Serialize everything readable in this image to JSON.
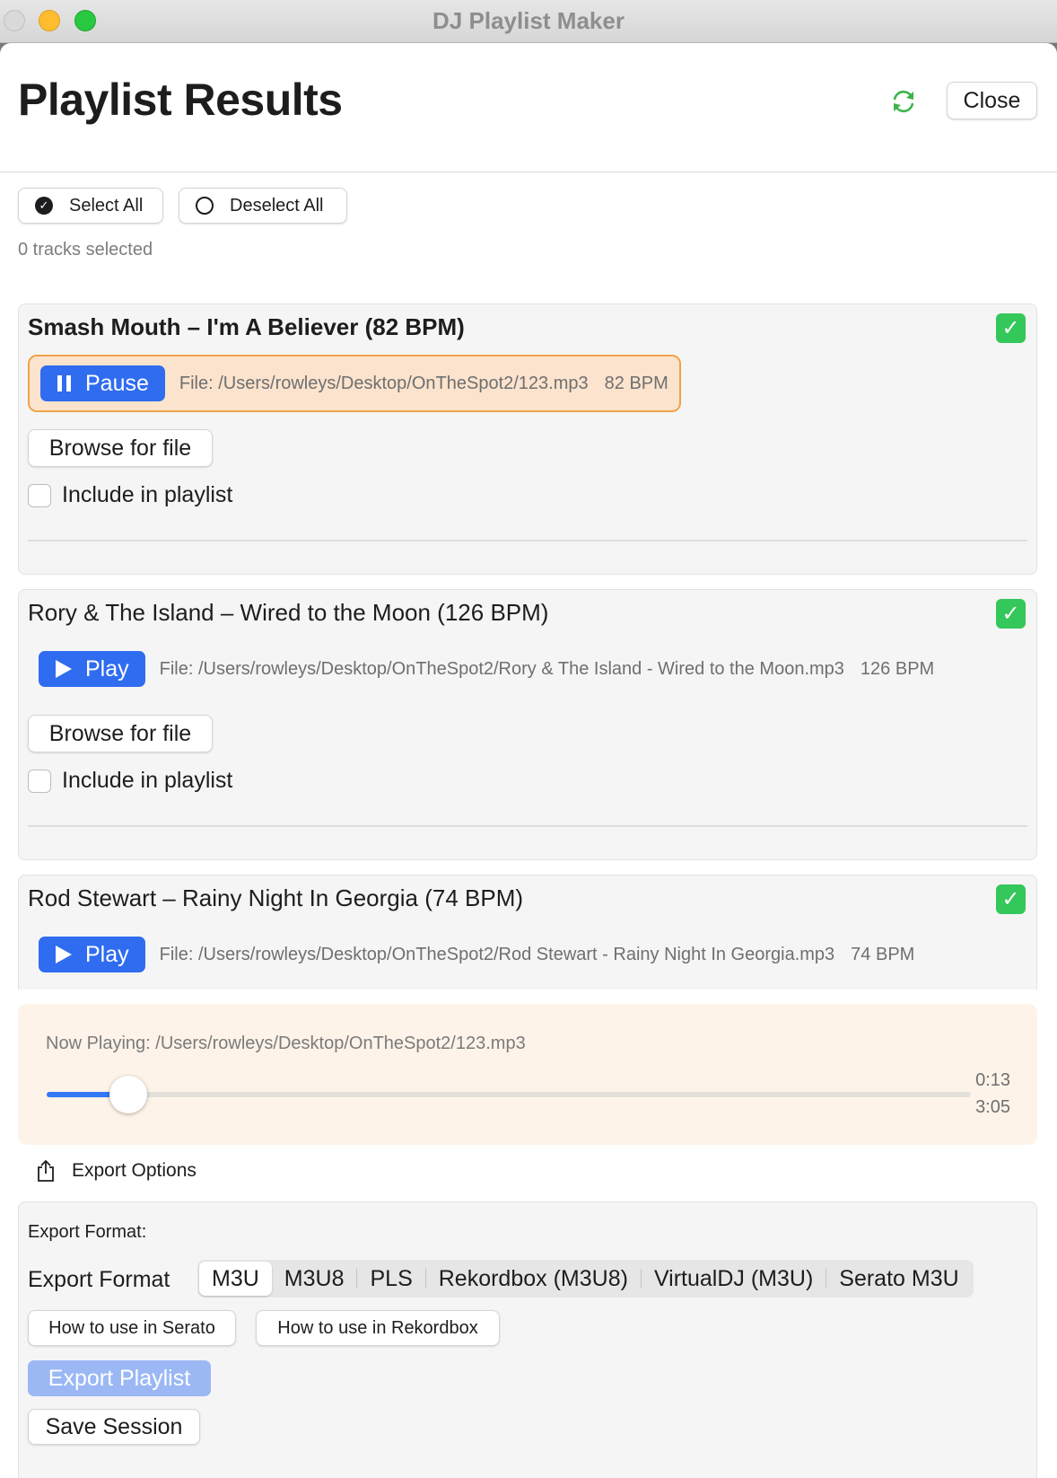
{
  "window": {
    "title": "DJ Playlist Maker"
  },
  "header": {
    "title": "Playlist Results",
    "close_label": "Close"
  },
  "selection": {
    "select_all_label": "Select All",
    "deselect_all_label": "Deselect All",
    "count_text": "0 tracks selected"
  },
  "tracks": [
    {
      "title": "Smash Mouth – I'm A Believer (82 BPM)",
      "play_label": "Pause",
      "file_text": "File: /Users/rowleys/Desktop/OnTheSpot2/123.mp3",
      "bpm_text": "82 BPM",
      "browse_label": "Browse for file",
      "include_label": "Include in playlist",
      "check_glyph": "✓"
    },
    {
      "title": "Rory & The Island – Wired to the Moon (126 BPM)",
      "play_label": "Play",
      "file_text": "File: /Users/rowleys/Desktop/OnTheSpot2/Rory & The Island - Wired to the Moon.mp3",
      "bpm_text": "126 BPM",
      "browse_label": "Browse for file",
      "include_label": "Include in playlist",
      "check_glyph": "✓"
    },
    {
      "title": "Rod Stewart – Rainy Night In Georgia (74 BPM)",
      "play_label": "Play",
      "file_text": "File: /Users/rowleys/Desktop/OnTheSpot2/Rod Stewart - Rainy Night In Georgia.mp3",
      "bpm_text": "74 BPM",
      "check_glyph": "✓"
    }
  ],
  "now_playing": {
    "label": "Now Playing: /Users/rowleys/Desktop/OnTheSpot2/123.mp3",
    "elapsed": "0:13",
    "total": "3:05",
    "progress_fraction": 0.088
  },
  "export": {
    "section_label": "Export Options",
    "format_title": "Export Format:",
    "format_label": "Export Format",
    "formats": [
      "M3U",
      "M3U8",
      "PLS",
      "Rekordbox (M3U8)",
      "VirtualDJ (M3U)",
      "Serato M3U"
    ],
    "selected_format": "M3U",
    "howto_serato_label": "How to use in Serato",
    "howto_rekordbox_label": "How to use in Rekordbox",
    "export_label": "Export Playlist",
    "save_label": "Save Session"
  },
  "colors": {
    "accent": "#2f6cf0",
    "success": "#34c759",
    "playing_bg": "#fbe3cd",
    "playing_border": "#f0a34a"
  },
  "icons": [
    "refresh-icon",
    "pause-icon",
    "play-icon",
    "checkmark-icon",
    "share-icon"
  ]
}
